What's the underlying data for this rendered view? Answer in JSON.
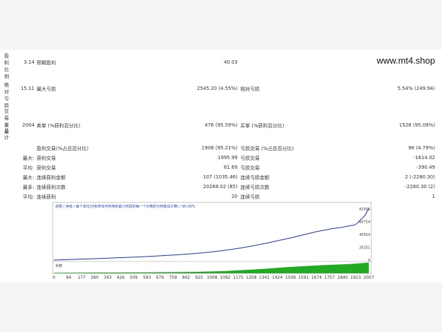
{
  "watermark": "www.mt4.shop",
  "side_labels": {
    "group1": "盈利比例",
    "group2": "绝对亏损",
    "group3": "交易量单",
    "group4": "总计"
  },
  "stats": [
    {
      "left_value": "3.14",
      "left_label": "预期盈利",
      "mid_value": "40.03",
      "right_label": "",
      "right_value": ""
    },
    {
      "left_value": "15.11",
      "left_label": "最大亏损",
      "mid_value": "2545.20 (4.55%)",
      "right_label": "相对亏损",
      "right_value": "5.54% (249.94)"
    },
    {
      "left_value": "2004",
      "left_label": "卖单 (%获利百分比)",
      "mid_value": "476 (95.59%)",
      "right_label": "买单 (%获利百分比)",
      "right_value": "1528 (95.09%)"
    }
  ],
  "details": [
    {
      "prefix": "",
      "label": "盈利交易(%占总百分比)",
      "value": "1908 (95.21%)",
      "right_label": "亏损交易 (%占总百分比)",
      "right_value": "96 (4.79%)"
    },
    {
      "prefix": "最大:",
      "label": "获利交易",
      "value": "1995.99",
      "right_label": "亏损交易",
      "right_value": "-1614.02"
    },
    {
      "prefix": "平均",
      "label": "获利交易",
      "value": "61.69",
      "right_label": "亏损交易",
      "right_value": "-390.49"
    },
    {
      "prefix": "最大:",
      "label": "连续获利金额",
      "value": "107 (1035.46)",
      "right_label": "连续亏损金额",
      "right_value": "2 (-2280.30)"
    },
    {
      "prefix": "最多:",
      "label": "连续获利次数",
      "value": "20268.02 (85)",
      "right_label": "连续亏损次数",
      "right_value": "-2280.30 (2)"
    },
    {
      "prefix": "平均:",
      "label": "连续获利",
      "value": "20",
      "right_label": "连续亏损",
      "right_value": "1"
    }
  ],
  "chart_header": "余额 / 净值 / 每个单位分钟(所有可利用的最小时段的每一个价格的分钟建设计算) / 90.00%",
  "volume_label": "手数",
  "chart_data": {
    "type": "line",
    "x_ticks": [
      "0",
      "94",
      "177",
      "260",
      "343",
      "426",
      "509",
      "593",
      "676",
      "759",
      "842",
      "925",
      "1008",
      "1092",
      "1175",
      "1258",
      "1341",
      "1424",
      "1508",
      "1591",
      "1674",
      "1757",
      "1840",
      "1923",
      "2007"
    ],
    "y_ticks": [
      "81006",
      "60754",
      "40503",
      "20251",
      "0"
    ],
    "xlim": [
      0,
      2007
    ],
    "ylim": [
      0,
      81006
    ],
    "series": [
      {
        "values": [
          [
            0,
            0
          ],
          [
            94,
            800
          ],
          [
            177,
            1500
          ],
          [
            260,
            2200
          ],
          [
            343,
            3000
          ],
          [
            426,
            3800
          ],
          [
            509,
            4700
          ],
          [
            593,
            5600
          ],
          [
            676,
            6700
          ],
          [
            759,
            7900
          ],
          [
            842,
            9300
          ],
          [
            925,
            11000
          ],
          [
            1008,
            13000
          ],
          [
            1092,
            15500
          ],
          [
            1175,
            18500
          ],
          [
            1258,
            22000
          ],
          [
            1341,
            26000
          ],
          [
            1424,
            30500
          ],
          [
            1508,
            35000
          ],
          [
            1591,
            40000
          ],
          [
            1674,
            45000
          ],
          [
            1757,
            49000
          ],
          [
            1840,
            52000
          ],
          [
            1923,
            56000
          ],
          [
            1980,
            70000
          ],
          [
            2007,
            81006
          ]
        ]
      }
    ],
    "volume": [
      [
        0,
        2
      ],
      [
        300,
        3
      ],
      [
        600,
        4
      ],
      [
        900,
        6
      ],
      [
        1100,
        10
      ],
      [
        1300,
        18
      ],
      [
        1500,
        28
      ],
      [
        1700,
        36
      ],
      [
        1900,
        42
      ],
      [
        2007,
        48
      ]
    ],
    "colors": {
      "line": "#1a2fa8",
      "volume": "#22aa22",
      "header": "#2a44b8"
    }
  }
}
